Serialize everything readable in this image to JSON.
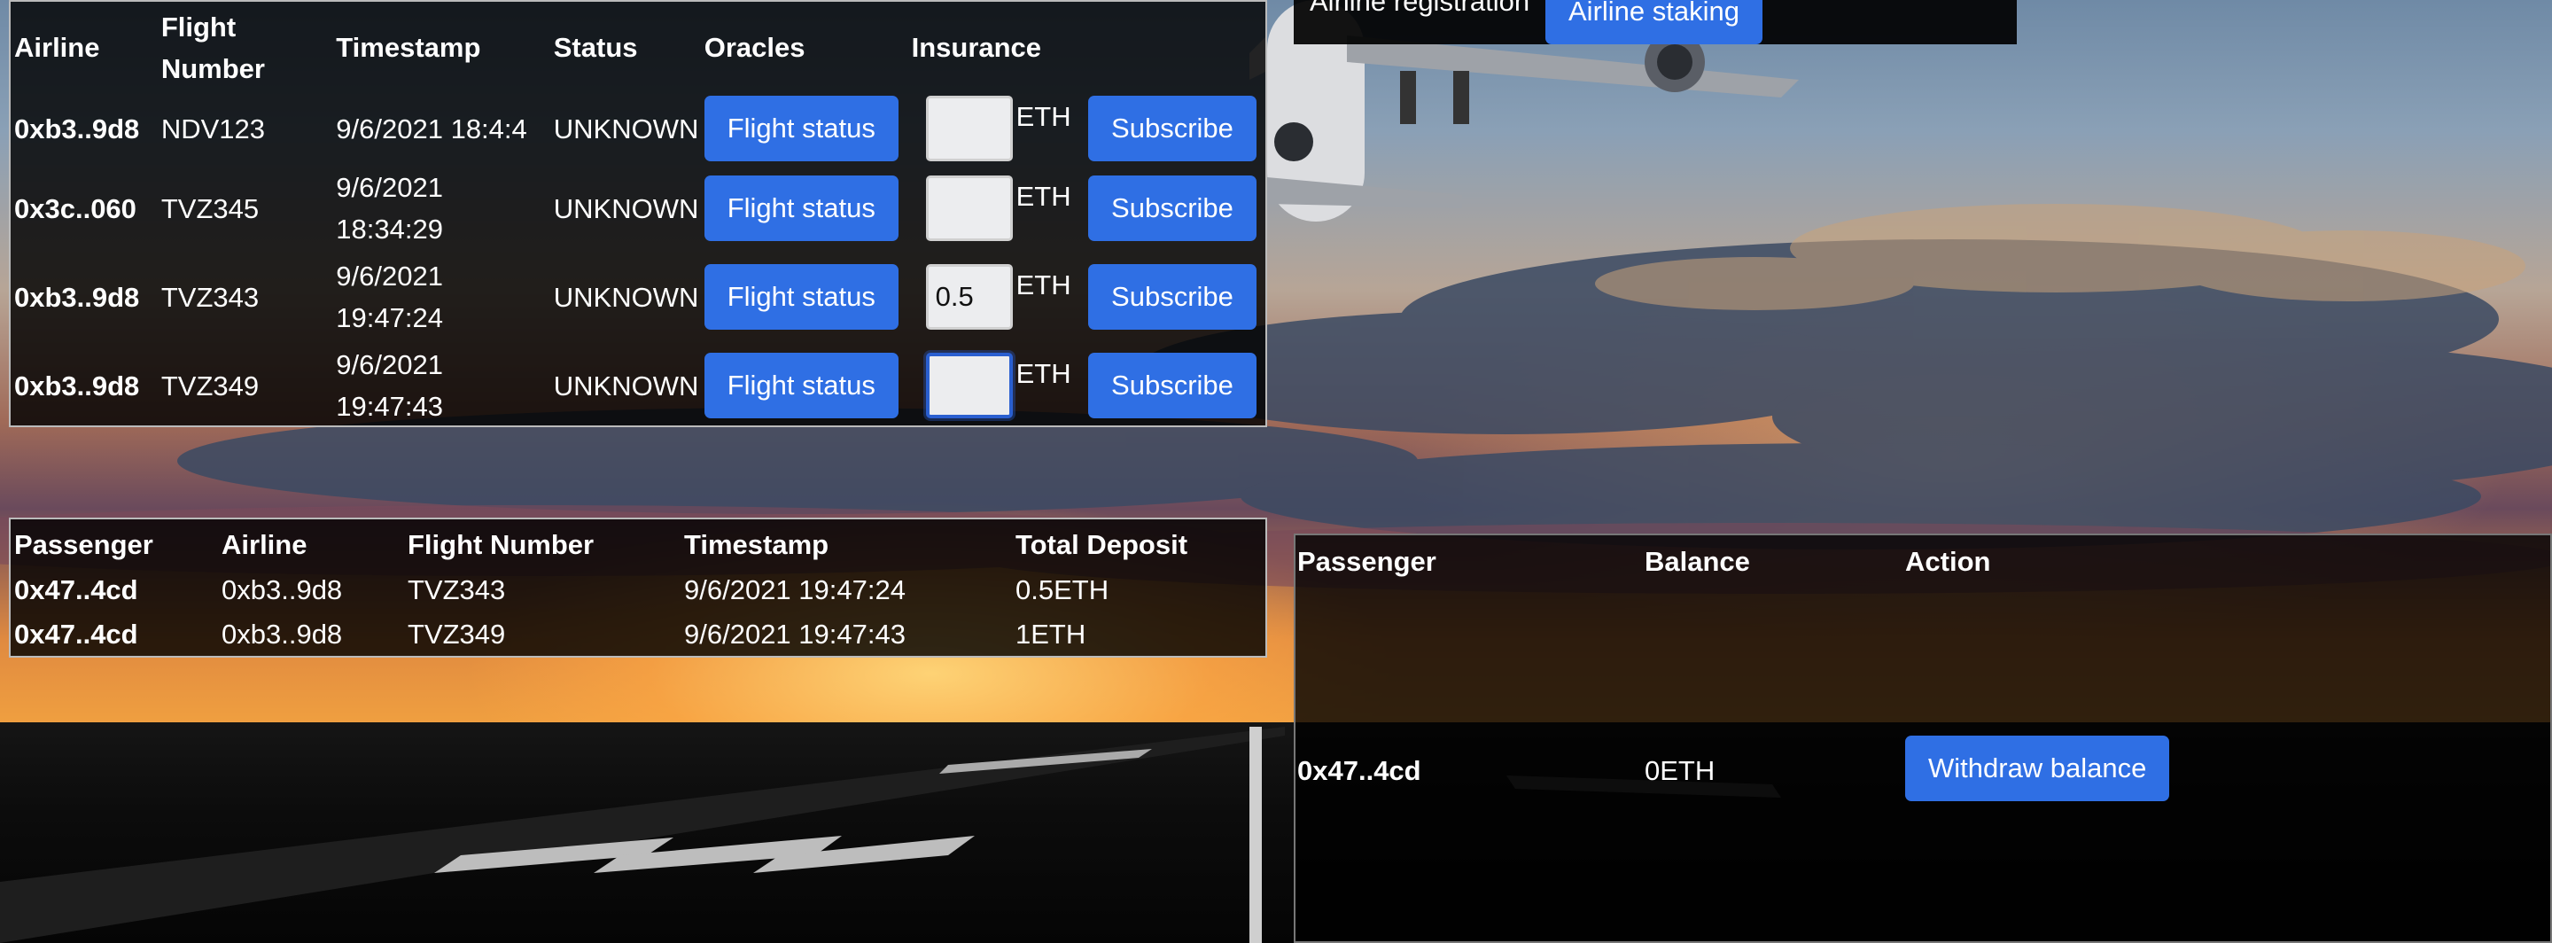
{
  "top_bar": {
    "label": "Airline registration",
    "staking_button": "Airline staking"
  },
  "flights": {
    "headers": [
      "Airline",
      "Flight Number",
      "Timestamp",
      "Status",
      "Oracles",
      "Insurance"
    ],
    "header_flight_line1": "Flight",
    "header_flight_line2": "Number",
    "rows": [
      {
        "airline": "0xb3..9d8",
        "flight": "NDV123",
        "ts1": "9/6/2021 18:4:4",
        "ts2": "",
        "status": "UNKNOWN",
        "oracle_button": "Flight status",
        "insurance_value": "",
        "unit": "ETH",
        "subscribe_button": "Subscribe"
      },
      {
        "airline": "0x3c..060",
        "flight": "TVZ345",
        "ts1": "9/6/2021",
        "ts2": "18:34:29",
        "status": "UNKNOWN",
        "oracle_button": "Flight status",
        "insurance_value": "",
        "unit": "ETH",
        "subscribe_button": "Subscribe"
      },
      {
        "airline": "0xb3..9d8",
        "flight": "TVZ343",
        "ts1": "9/6/2021",
        "ts2": "19:47:24",
        "status": "UNKNOWN",
        "oracle_button": "Flight status",
        "insurance_value": "0.5",
        "unit": "ETH",
        "subscribe_button": "Subscribe"
      },
      {
        "airline": "0xb3..9d8",
        "flight": "TVZ349",
        "ts1": "9/6/2021",
        "ts2": "19:47:43",
        "status": "UNKNOWN",
        "oracle_button": "Flight status",
        "insurance_value": "",
        "unit": "ETH",
        "subscribe_button": "Subscribe"
      }
    ]
  },
  "deposits": {
    "headers": [
      "Passenger",
      "Airline",
      "Flight Number",
      "Timestamp",
      "Total Deposit"
    ],
    "rows": [
      {
        "passenger": "0x47..4cd",
        "airline": "0xb3..9d8",
        "flight": "TVZ343",
        "timestamp": "9/6/2021 19:47:24",
        "deposit": "0.5ETH"
      },
      {
        "passenger": "0x47..4cd",
        "airline": "0xb3..9d8",
        "flight": "TVZ349",
        "timestamp": "9/6/2021 19:47:43",
        "deposit": "1ETH"
      }
    ]
  },
  "balances": {
    "headers": [
      "Passenger",
      "Balance",
      "Action"
    ],
    "rows": [
      {
        "passenger": "0x47..4cd",
        "balance": "0ETH",
        "action_button": "Withdraw balance"
      }
    ]
  },
  "colors": {
    "button": "#2f6fe4",
    "panel_bg": "#000000",
    "text": "#ffffff"
  }
}
